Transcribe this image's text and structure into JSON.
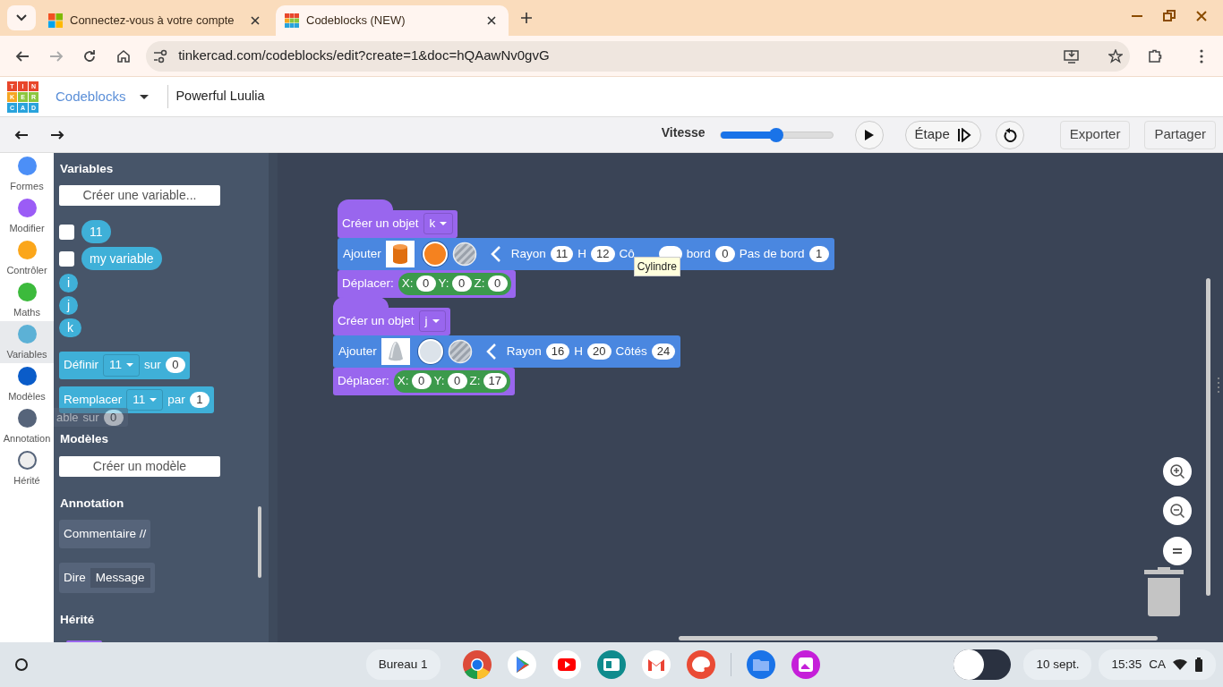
{
  "browser": {
    "tabs": [
      {
        "title": "Connectez-vous à votre compte",
        "selected": false
      },
      {
        "title": "Codeblocks (NEW)",
        "selected": true
      }
    ],
    "url": "tinkercad.com/codeblocks/edit?create=1&doc=hQAawNv0gvG"
  },
  "app": {
    "logo": [
      "T",
      "I",
      "N",
      "K",
      "E",
      "R",
      "C",
      "A",
      "D"
    ],
    "mode": "Codeblocks",
    "project": "Powerful Luulia"
  },
  "toolbar": {
    "speed_label": "Vitesse",
    "speed": {
      "level": 0.5
    },
    "step_label": "Étape",
    "buttons": [
      "Exporter",
      "Partager"
    ]
  },
  "categories": [
    {
      "label": "Formes",
      "color": "#4c8ff7",
      "selected": false
    },
    {
      "label": "Modifier",
      "color": "#9b5cf6",
      "selected": false
    },
    {
      "label": "Contrôler",
      "color": "#fba61a",
      "selected": false
    },
    {
      "label": "Maths",
      "color": "#3cba3c",
      "selected": false
    },
    {
      "label": "Variables",
      "color": "#5cb1d6",
      "selected": true
    },
    {
      "label": "Modèles",
      "color": "#0a5cc9",
      "selected": false
    },
    {
      "label": "Annotation",
      "color": "#56647a",
      "selected": false
    },
    {
      "label": "Hérité",
      "color": "#eeeeee",
      "selected": false
    }
  ],
  "flyout": [
    {
      "kind": "heading",
      "text": "Variables"
    },
    {
      "kind": "button",
      "text": "Créer une variable..."
    },
    {
      "kind": "variable",
      "name": "11",
      "checked": false
    },
    {
      "kind": "variable",
      "name": "my variable",
      "checked": false
    },
    {
      "kind": "reporter",
      "name": "i"
    },
    {
      "kind": "reporter",
      "name": "j"
    },
    {
      "kind": "reporter",
      "name": "k"
    },
    {
      "kind": "block",
      "parts": [
        {
          "kind": "label",
          "text": "Définir"
        },
        {
          "kind": "dropdown",
          "text": "11"
        },
        {
          "kind": "label",
          "text": "sur"
        },
        {
          "kind": "pill",
          "text": "0"
        }
      ]
    },
    {
      "kind": "block",
      "parts": [
        {
          "kind": "label",
          "text": "Remplacer"
        },
        {
          "kind": "dropdown",
          "text": "11"
        },
        {
          "kind": "label",
          "text": "par"
        },
        {
          "kind": "pill",
          "text": "1"
        }
      ]
    },
    {
      "kind": "ghost",
      "parts": [
        {
          "kind": "label",
          "text": "able"
        },
        {
          "kind": "label",
          "text": "sur"
        },
        {
          "kind": "pill",
          "text": "0"
        }
      ]
    },
    {
      "kind": "heading",
      "text": "Modèles"
    },
    {
      "kind": "button",
      "text": "Créer un modèle"
    },
    {
      "kind": "heading",
      "text": "Annotation"
    },
    {
      "kind": "comment",
      "parts": [
        {
          "kind": "label",
          "text": "Commentaire //"
        }
      ]
    },
    {
      "kind": "comment",
      "parts": [
        {
          "kind": "label",
          "text": "Dire"
        },
        {
          "kind": "field",
          "text": "Message"
        }
      ]
    },
    {
      "kind": "heading",
      "text": "Hérité"
    },
    {
      "kind": "stub"
    }
  ],
  "workspace": {
    "stacks": [
      {
        "create": {
          "label": "Créer un objet",
          "variable": "k"
        },
        "add": {
          "label": "Ajouter",
          "color": "#f5821f",
          "params": [
            {
              "label": "Rayon",
              "value": "11"
            },
            {
              "label": "H",
              "value": "12"
            },
            {
              "label": "Cô"
            },
            {
              "label": "bord",
              "value": "0"
            },
            {
              "label": "Pas de bord",
              "value": "1"
            }
          ]
        },
        "move": {
          "label": "Déplacer:",
          "coords": [
            {
              "axis": "X:",
              "value": "0"
            },
            {
              "axis": "Y:",
              "value": "0"
            },
            {
              "axis": "Z:",
              "value": "0"
            }
          ]
        }
      },
      {
        "create": {
          "label": "Créer un objet",
          "variable": "j"
        },
        "add": {
          "label": "Ajouter",
          "color": "#dce3ea",
          "params": [
            {
              "label": "Rayon",
              "value": "16"
            },
            {
              "label": "H",
              "value": "20"
            },
            {
              "label": "Côtés",
              "value": "24"
            }
          ]
        },
        "move": {
          "label": "Déplacer:",
          "coords": [
            {
              "axis": "X:",
              "value": "0"
            },
            {
              "axis": "Y:",
              "value": "0"
            },
            {
              "axis": "Z:",
              "value": "17"
            }
          ]
        }
      }
    ],
    "tooltip": "Cylindre"
  },
  "taskbar": {
    "desk": "Bureau 1",
    "date": "10 sept.",
    "time": "15:35",
    "locale": "CA"
  }
}
